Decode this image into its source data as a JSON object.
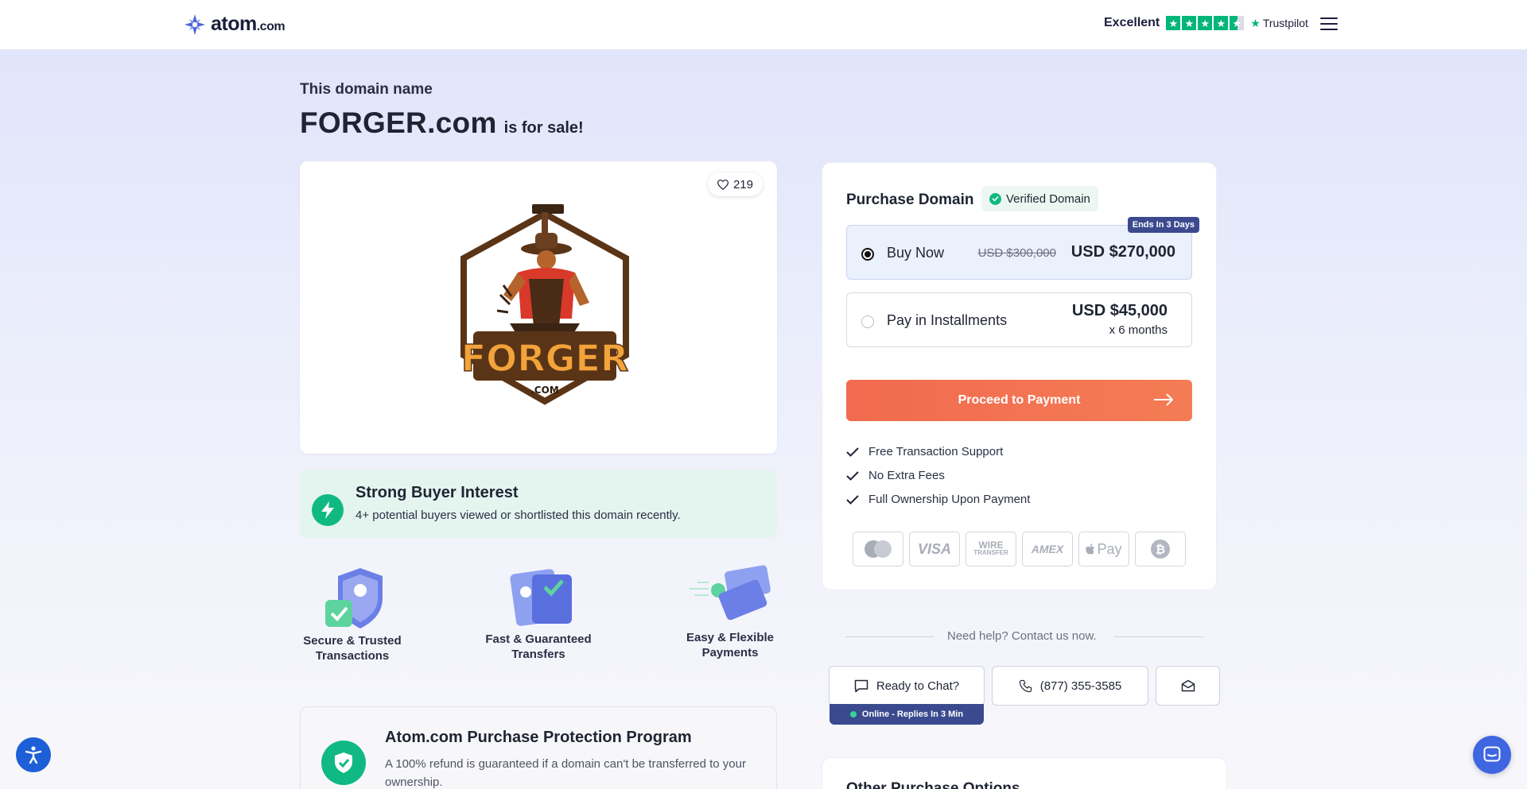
{
  "header": {
    "logo_text": "atom",
    "logo_suffix": ".com",
    "rating_label": "Excellent",
    "trustpilot": "Trustpilot"
  },
  "hero": {
    "eyebrow": "This domain name",
    "domain": "FORGER.com",
    "for_sale": "is for sale!"
  },
  "logo_card": {
    "likes": "219",
    "brand_word": "FORGER",
    "brand_suffix": ".COM"
  },
  "interest": {
    "title": "Strong Buyer Interest",
    "text": "4+ potential buyers viewed or shortlisted this domain recently."
  },
  "features": [
    {
      "line1": "Secure & Trusted",
      "line2": "Transactions"
    },
    {
      "line1": "Fast & Guaranteed",
      "line2": "Transfers"
    },
    {
      "line1": "Easy & Flexible",
      "line2": "Payments"
    }
  ],
  "protection": {
    "title": "Atom.com Purchase Protection Program",
    "text": "A 100% refund is guaranteed if a domain can't be transferred to your ownership."
  },
  "purchase": {
    "title": "Purchase Domain",
    "verified": "Verified Domain",
    "buy_now": {
      "label": "Buy Now",
      "old_price": "USD $300,000",
      "price": "USD $270,000",
      "badge": "Ends In 3 Days"
    },
    "installments": {
      "label": "Pay in Installments",
      "price": "USD $45,000",
      "term": "x 6 months"
    },
    "cta": "Proceed to Payment",
    "benefits": [
      "Free Transaction Support",
      "No Extra Fees",
      "Full Ownership Upon Payment"
    ],
    "payment_methods": {
      "visa": "VISA",
      "wire_line1": "WIRE",
      "wire_line2": "TRANSFER",
      "amex": "AMEX",
      "applepay": "Pay"
    }
  },
  "help": {
    "text": "Need help? Contact us now.",
    "chat": "Ready to Chat?",
    "online": "Online - Replies In 3 Min",
    "phone": "(877) 355-3585"
  },
  "other": {
    "title": "Other Purchase Options"
  },
  "colors": {
    "accent": "#f26a4f",
    "brand": "#3b4a8f",
    "success": "#10b981",
    "trustpilot": "#00b67a"
  }
}
